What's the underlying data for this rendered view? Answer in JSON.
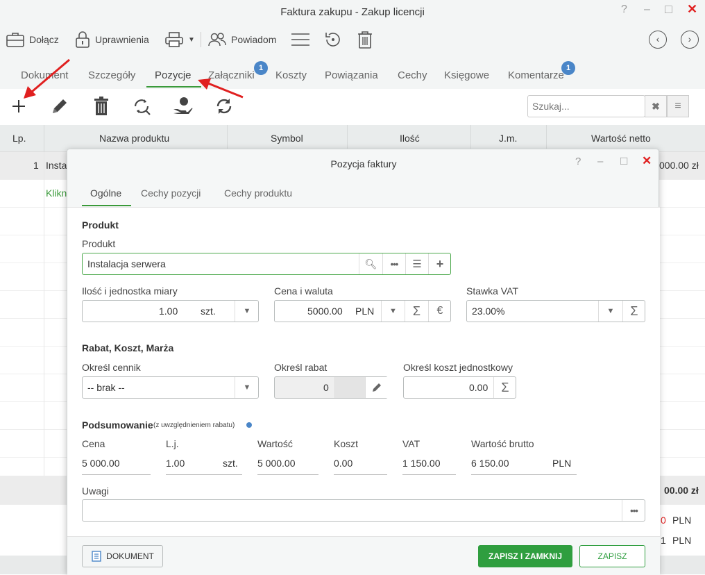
{
  "window": {
    "title": "Faktura zakupu - Zakup licencji"
  },
  "toolbar": {
    "attach": "Dołącz",
    "permissions": "Uprawnienia",
    "notify": "Powiadom"
  },
  "tabs": [
    {
      "label": "Dokument"
    },
    {
      "label": "Szczegóły"
    },
    {
      "label": "Pozycje"
    },
    {
      "label": "Załączniki",
      "badge": "1"
    },
    {
      "label": "Koszty"
    },
    {
      "label": "Powiązania"
    },
    {
      "label": "Cechy"
    },
    {
      "label": "Księgowe"
    },
    {
      "label": "Komentarze",
      "badge": "1"
    }
  ],
  "search": {
    "placeholder": "Szukaj..."
  },
  "grid": {
    "columns": [
      "Lp.",
      "Nazwa produktu",
      "Symbol",
      "Ilość",
      "J.m.",
      "Wartość netto"
    ],
    "row1": {
      "lp": "1",
      "name": "Insta",
      "value": "000.00 zł"
    },
    "add_hint": "Klikn",
    "total": "00.00 zł",
    "footer_values": [
      {
        "amount": "0",
        "currency": "PLN"
      },
      {
        "amount": "1",
        "currency": "PLN"
      }
    ]
  },
  "dialog": {
    "title": "Pozycja faktury",
    "tabs": [
      "Ogólne",
      "Cechy pozycji",
      "Cechy produktu"
    ],
    "product_section": "Produkt",
    "product_label": "Produkt",
    "product_value": "Instalacja serwera",
    "qty_label": "Ilość i jednostka miary",
    "qty_value": "1.00",
    "unit_value": "szt.",
    "price_label": "Cena i waluta",
    "price_value": "5000.00",
    "currency_value": "PLN",
    "vat_label": "Stawka VAT",
    "vat_value": "23.00%",
    "discount_section": "Rabat, Koszt, Marża",
    "pricelist_label": "Określ cennik",
    "pricelist_value": "-- brak --",
    "discount_label": "Określ rabat",
    "discount_value": "0",
    "unitcost_label": "Określ koszt jednostkowy",
    "unitcost_value": "0.00",
    "summary_section": "Podsumowanie",
    "summary_note": "(z uwzględnieniem rabatu)",
    "summary": {
      "price_label": "Cena",
      "price": "5 000.00",
      "qty_label": "L.j.",
      "qty": "1.00",
      "unit": "szt.",
      "value_label": "Wartość",
      "value": "5 000.00",
      "cost_label": "Koszt",
      "cost": "0.00",
      "vat_label": "VAT",
      "vat": "1 150.00",
      "gross_label": "Wartość brutto",
      "gross": "6 150.00",
      "currency": "PLN"
    },
    "notes_label": "Uwagi",
    "doc_button": "DOKUMENT",
    "save_close_button": "ZAPISZ I ZAMKNIJ",
    "save_button": "ZAPISZ"
  },
  "colors": {
    "accent": "#3a9a3a",
    "badge": "#4a86c8",
    "close": "#e02020",
    "arrow": "#e02020"
  }
}
